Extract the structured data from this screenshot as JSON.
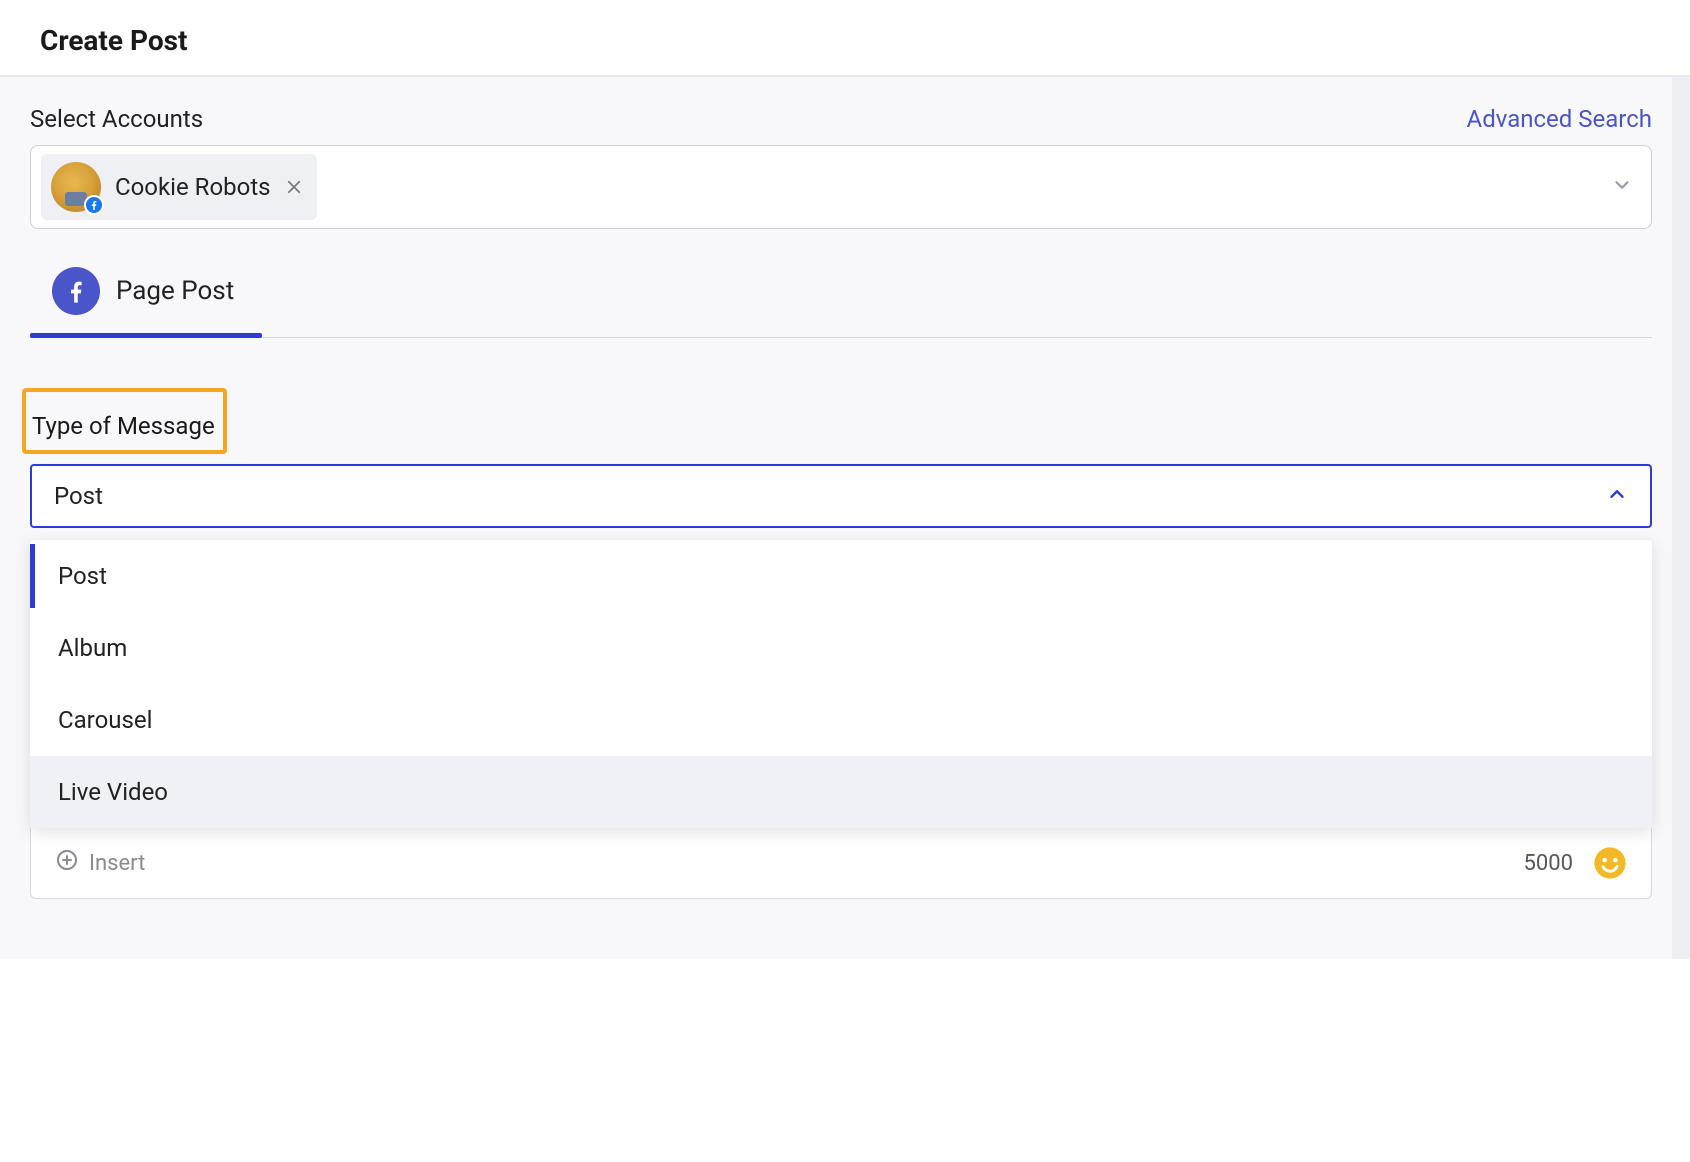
{
  "header": {
    "title": "Create Post"
  },
  "accounts": {
    "section_label": "Select Accounts",
    "advanced_search": "Advanced Search",
    "selected": {
      "name": "Cookie Robots"
    }
  },
  "tabs": {
    "page_post": "Page Post"
  },
  "type_of_message": {
    "label": "Type of Message",
    "hint": "(Post, Album, Carousel, Live Video)",
    "selected": "Post",
    "options": [
      "Post",
      "Album",
      "Carousel",
      "Live Video"
    ]
  },
  "bottom_bar": {
    "insert_label": "Insert",
    "char_count": "5000"
  }
}
